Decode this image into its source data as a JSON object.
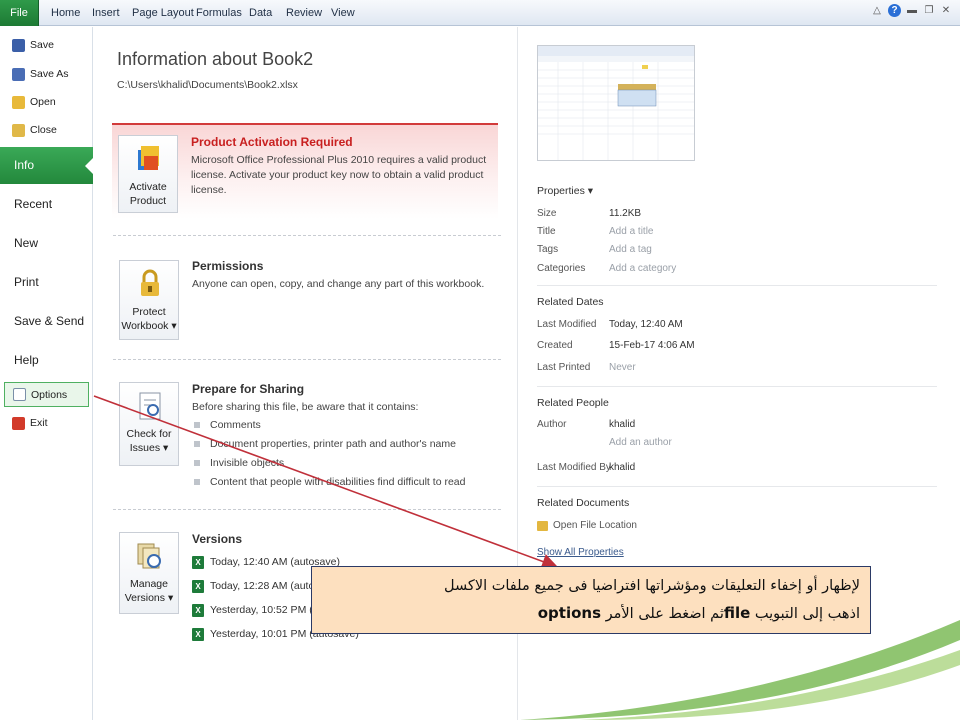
{
  "ribbon": {
    "file_tab": "File",
    "tabs": [
      "Home",
      "Insert",
      "Page Layout",
      "Formulas",
      "Data",
      "Review",
      "View"
    ]
  },
  "nav": {
    "save": "Save",
    "save_as": "Save As",
    "open": "Open",
    "close": "Close",
    "info": "Info",
    "recent": "Recent",
    "new": "New",
    "print": "Print",
    "save_send": "Save & Send",
    "help": "Help",
    "options": "Options",
    "exit": "Exit"
  },
  "info": {
    "title": "Information about Book2",
    "path": "C:\\Users\\khalid\\Documents\\Book2.xlsx",
    "activation": {
      "button_line1": "Activate",
      "button_line2": "Product",
      "title": "Product Activation Required",
      "text": "Microsoft Office Professional Plus 2010 requires a valid product license. Activate your product key now to obtain a valid product license."
    },
    "permissions": {
      "button_line1": "Protect",
      "button_line2": "Workbook",
      "title": "Permissions",
      "text": "Anyone can open, copy, and change any part of this workbook."
    },
    "sharing": {
      "button_line1": "Check for",
      "button_line2": "Issues",
      "title": "Prepare for Sharing",
      "text": "Before sharing this file, be aware that it contains:",
      "items": [
        "Comments",
        "Document properties, printer path and author's name",
        "Invisible objects",
        "Content that people with disabilities find difficult to read"
      ]
    },
    "versions": {
      "button_line1": "Manage",
      "button_line2": "Versions",
      "title": "Versions",
      "items": [
        "Today, 12:40 AM (autosave)",
        "Today, 12:28 AM (autosave)",
        "Yesterday, 10:52 PM (autosave)",
        "Yesterday, 10:01 PM (autosave)"
      ]
    }
  },
  "props": {
    "properties_header": "Properties",
    "size_label": "Size",
    "size_value": "11.2KB",
    "title_label": "Title",
    "title_value": "Add a title",
    "tags_label": "Tags",
    "tags_value": "Add a tag",
    "categories_label": "Categories",
    "categories_value": "Add a category",
    "related_dates_header": "Related Dates",
    "last_modified_label": "Last Modified",
    "last_modified_value": "Today, 12:40 AM",
    "created_label": "Created",
    "created_value": "15-Feb-17 4:06 AM",
    "last_printed_label": "Last Printed",
    "last_printed_value": "Never",
    "related_people_header": "Related People",
    "author_label": "Author",
    "author_value": "khalid",
    "add_author": "Add an author",
    "last_modified_by_label": "Last Modified By",
    "last_modified_by_value": "khalid",
    "related_documents_header": "Related Documents",
    "open_file_location": "Open File Location",
    "show_all_properties": "Show All Properties"
  },
  "callout": {
    "line1": "لإظهار أو إخفاء التعليقات ومؤشراتها افتراضيا فى جميع ملفات الاكسل",
    "line2_part1": "اذهب إلى التبويب",
    "line2_kw1": "file",
    "line2_part2": "ثم اضغط على الأمر",
    "line2_kw2": "options"
  },
  "colors": {
    "file_tab_green": "#1d7a34",
    "info_green": "#2f9a4a",
    "activation_red": "#c82020",
    "callout_bg": "#fde0bf",
    "arrow_red": "#c0303a"
  }
}
